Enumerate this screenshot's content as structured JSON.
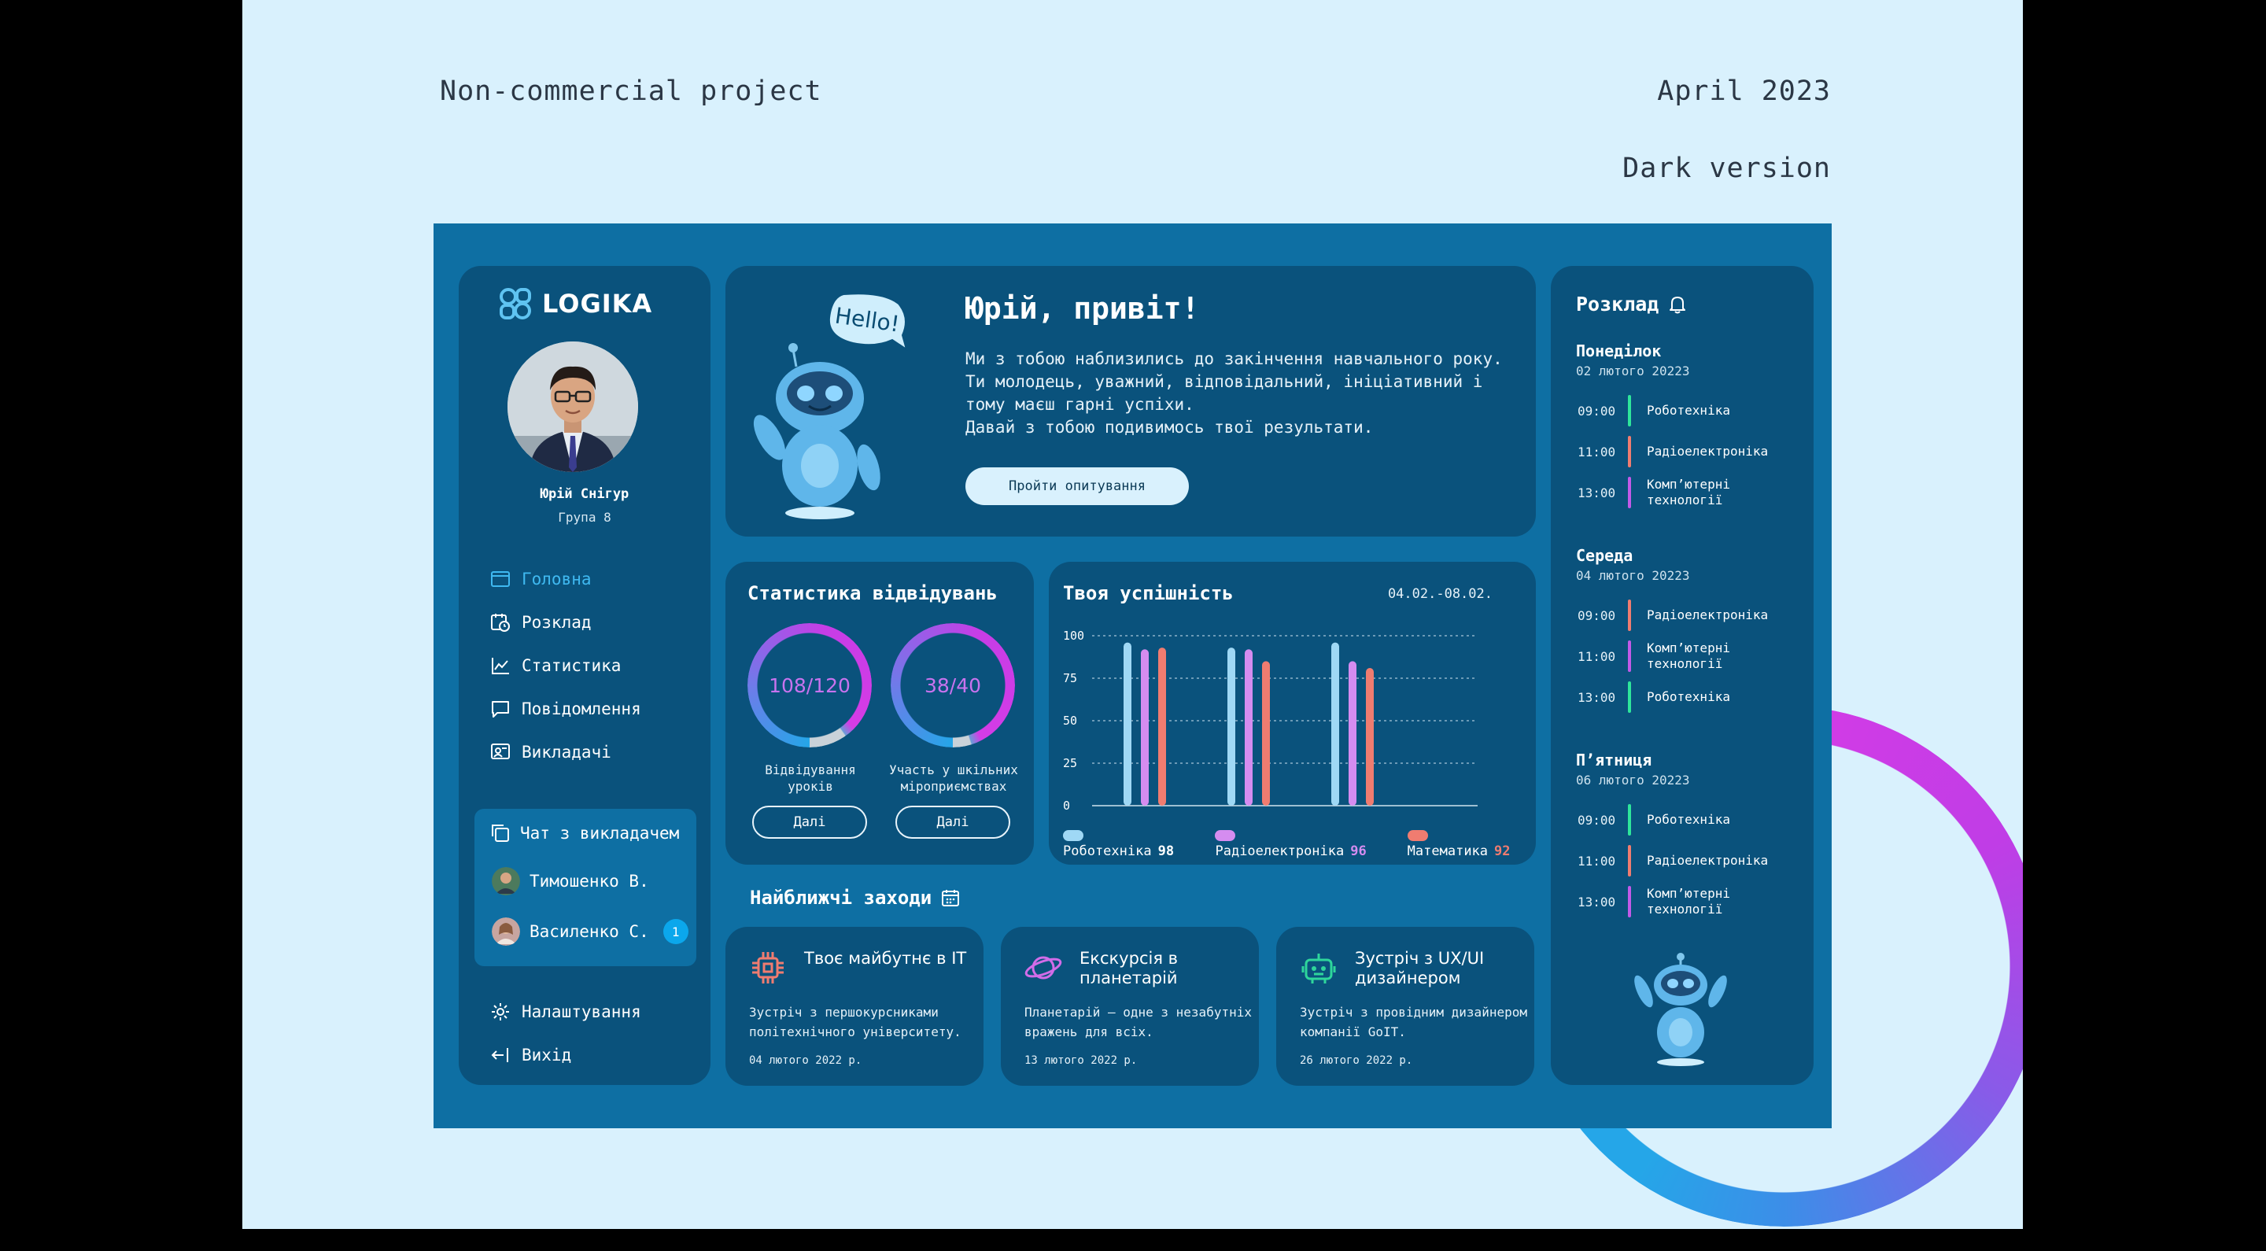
{
  "page": {
    "left_note": "Non-commercial project",
    "right_note": "April 2023",
    "version_note": "Dark version"
  },
  "sidebar": {
    "brand": "LOGIKA",
    "user_name": "Юрій Снігур",
    "user_group": "Група 8",
    "nav": [
      {
        "label": "Головна",
        "icon": "window-icon",
        "active": true
      },
      {
        "label": "Розклад",
        "icon": "calendar-clock-icon"
      },
      {
        "label": "Статистика",
        "icon": "chart-line-icon"
      },
      {
        "label": "Повідомлення",
        "icon": "message-icon"
      },
      {
        "label": "Викладачі",
        "icon": "teacher-icon"
      }
    ],
    "chat": {
      "title": "Чат з викладачем",
      "contacts": [
        {
          "name": "Тимошенко В."
        },
        {
          "name": "Василенко С.",
          "unread": "1"
        }
      ]
    },
    "settings": "Налаштування",
    "logout": "Вихід"
  },
  "welcome": {
    "bubble": "Hello!",
    "title": "Юрій, привіт!",
    "text": "Ми з тобою наблизились до закінчення навчального року.\nТи молодець, уважний, відповідальний, ініціативний і\nтому маєш гарні успіхи.\nДавай з тобою подивимось твої результати.",
    "button": "Пройти опитування"
  },
  "stats": {
    "title": "Статистика відвідувань",
    "rings": [
      {
        "value": "108/120",
        "label": "Відвідування\nуроків",
        "fraction": 0.9,
        "button": "Далі"
      },
      {
        "value": "38/40",
        "label": "Участь у шкільних\nміроприємствах",
        "fraction": 0.95,
        "button": "Далі"
      }
    ]
  },
  "performance": {
    "title": "Твоя успішність",
    "range": "04.02.-08.02."
  },
  "chart_data": {
    "type": "bar",
    "title": "Твоя успішність",
    "ylim": [
      0,
      100
    ],
    "yticks": [
      "100",
      "75",
      "50",
      "25",
      "0"
    ],
    "grid": true,
    "legend_position": "bottom",
    "categories": [
      "",
      "",
      ""
    ],
    "series": [
      {
        "name": "Роботехніка",
        "total": "98",
        "color": "#9fd8f5",
        "values": [
          96,
          93,
          96
        ]
      },
      {
        "name": "Радіоелектроніка",
        "total": "96",
        "color": "#d58cf0",
        "values": [
          92,
          92,
          85
        ]
      },
      {
        "name": "Математика",
        "total": "92",
        "color": "#f07c70",
        "values": [
          93,
          85,
          81
        ]
      }
    ]
  },
  "events": {
    "title": "Найближчі заходи",
    "items": [
      {
        "title": "Твоє майбутнє в IT",
        "desc": "Зустріч з першокурсниками політехнічного університету.",
        "date": "04 лютого 2022 р.",
        "icon": "chip-icon",
        "color": "#f07c70"
      },
      {
        "title": "Екскурсія в планетарій",
        "desc": "Планетарій – одне з незабутніх вражень для всіх.",
        "date": "13 лютого 2022 р.",
        "icon": "planet-icon",
        "color": "#d26ce8"
      },
      {
        "title": "Зустріч з UX/UI дизайнером",
        "desc": "Зустріч з провідним дизайнером компанії GoIT.",
        "date": "26 лютого 2022 р.",
        "icon": "robot-icon",
        "color": "#2ed69b"
      }
    ]
  },
  "schedule": {
    "title": "Розклад",
    "days": [
      {
        "day": "Понеділок",
        "date": "02 лютого 20223",
        "lessons": [
          {
            "time": "09:00",
            "name": "Роботехніка",
            "color": "#2ee69b"
          },
          {
            "time": "11:00",
            "name": "Радіоелектроніка",
            "color": "#f07c70"
          },
          {
            "time": "13:00",
            "name": "Комп’ютерні\nтехнології",
            "color": "#c35ae8"
          }
        ]
      },
      {
        "day": "Середа",
        "date": "04 лютого 20223",
        "lessons": [
          {
            "time": "09:00",
            "name": "Радіоелектроніка",
            "color": "#f07c70"
          },
          {
            "time": "11:00",
            "name": "Комп’ютерні\nтехнології",
            "color": "#c35ae8"
          },
          {
            "time": "13:00",
            "name": "Роботехніка",
            "color": "#2ee69b"
          }
        ]
      },
      {
        "day": "П’ятниця",
        "date": "06 лютого 20223",
        "lessons": [
          {
            "time": "09:00",
            "name": "Роботехніка",
            "color": "#2ee69b"
          },
          {
            "time": "11:00",
            "name": "Радіоелектроніка",
            "color": "#f07c70"
          },
          {
            "time": "13:00",
            "name": "Комп’ютерні\nтехнології",
            "color": "#c35ae8"
          }
        ]
      }
    ]
  }
}
